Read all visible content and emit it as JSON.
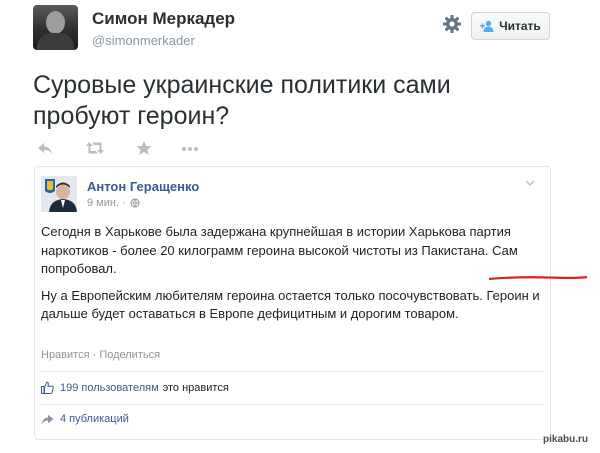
{
  "tweet": {
    "author_name": "Симон Меркадер",
    "author_handle": "@simonmerkader",
    "follow_label": "Читать",
    "text": "Суровые украинские политики сами пробуют героин?",
    "actions": [
      "reply-icon",
      "retweet-icon",
      "favorite-icon",
      "more-icon"
    ]
  },
  "embedded_post": {
    "author": "Антон Геращенко",
    "time": "9 мин. ·",
    "paragraph1_prefix": "Сегодня в Харькове была задержана крупнейшая в истории Харькова партия наркотиков - более 20 килограмм героина высокой чистоты из Пакистана. ",
    "paragraph1_highlight": "Сам попробовал.",
    "paragraph2": "Ну а Европейским любителям героина остается только посочувствовать. Героин и дальше будет оставаться в Европе дефицитным и дорогим товаром.",
    "links": "Нравится · Поделиться",
    "likes_count": "199 пользователям",
    "likes_suffix": "это нравится",
    "shares": "4 публикаций"
  },
  "watermark": "pikabu.ru",
  "colors": {
    "link": "#3b5998",
    "underline": "#d9232a"
  }
}
